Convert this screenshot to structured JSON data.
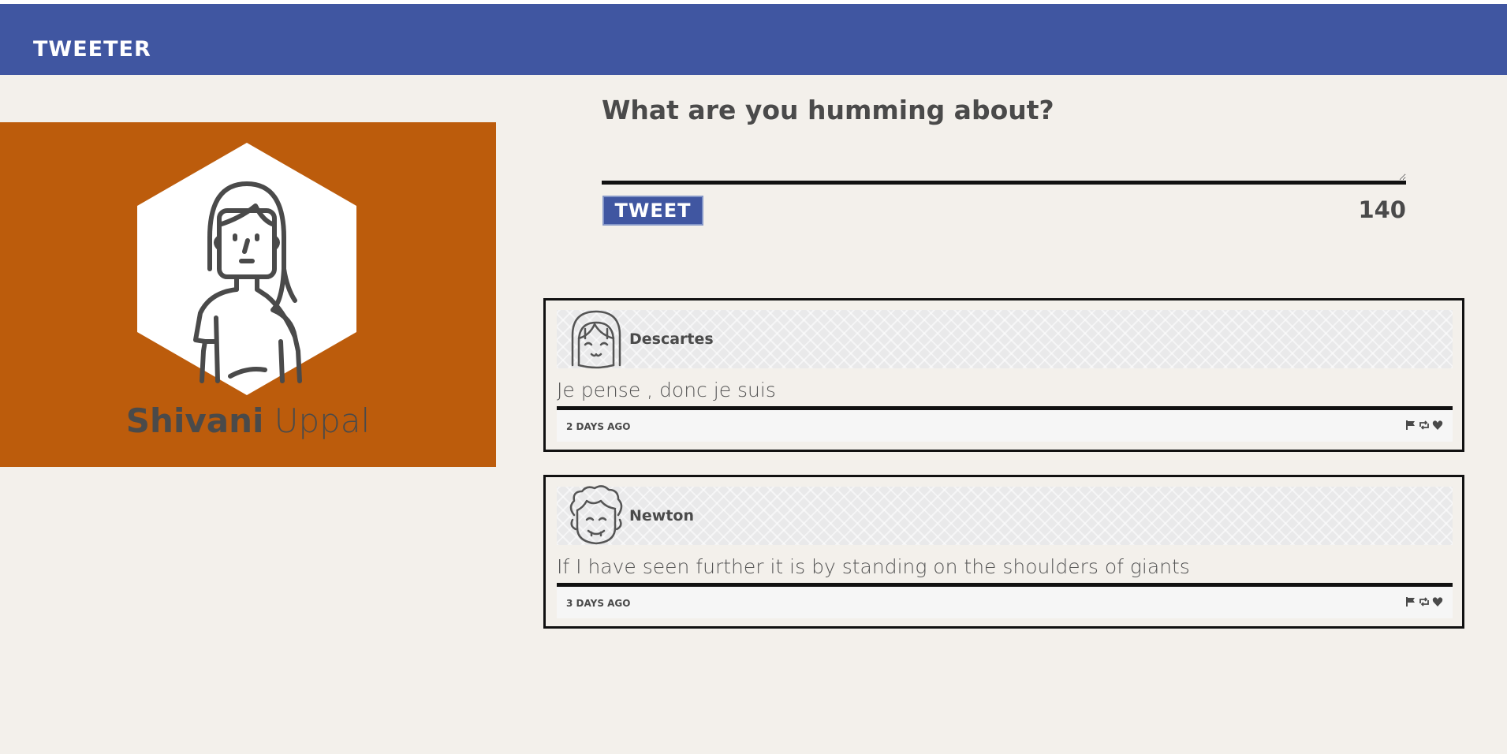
{
  "app": {
    "brand": "TWEETER",
    "brand_color": "#4056a1",
    "accent_color": "#bc5c0c"
  },
  "profile": {
    "first_name": "Shivani",
    "last_name": "Uppal",
    "avatar_icon": "female-avatar-icon"
  },
  "composer": {
    "prompt": "What are you humming about?",
    "input_value": "",
    "button_label": "TWEET",
    "char_counter": "140"
  },
  "tweets": [
    {
      "author": "Descartes",
      "avatar_icon": "girl-avatar-icon",
      "text": "Je pense , donc je suis",
      "time": "2 DAYS AGO",
      "actions": [
        "flag-icon",
        "retweet-icon",
        "heart-icon"
      ]
    },
    {
      "author": "Newton",
      "avatar_icon": "curly-hair-avatar-icon",
      "text": "If I have seen further it is by standing on the shoulders of giants",
      "time": "3 DAYS AGO",
      "actions": [
        "flag-icon",
        "retweet-icon",
        "heart-icon"
      ]
    }
  ]
}
